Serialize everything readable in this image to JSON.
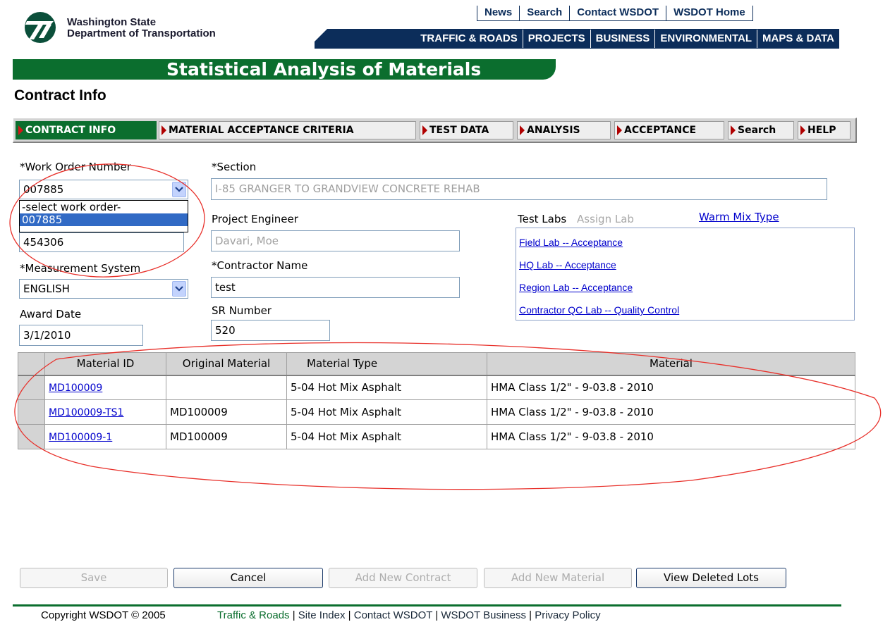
{
  "header": {
    "logo_line1": "Washington State",
    "logo_line2": "Department of Transportation",
    "logo_icon": "wsdot-logo-icon",
    "util_links": [
      "News",
      "Search",
      "Contact WSDOT",
      "WSDOT Home"
    ],
    "nav_items": [
      "TRAFFIC & ROADS",
      "PROJECTS",
      "BUSINESS",
      "ENVIRONMENTAL",
      "MAPS & DATA"
    ],
    "banner_title": "Statistical Analysis of Materials",
    "page_title": "Contract Info"
  },
  "tabs": [
    {
      "label": "CONTRACT INFO",
      "active": true
    },
    {
      "label": "MATERIAL ACCEPTANCE CRITERIA",
      "active": false
    },
    {
      "label": "TEST DATA",
      "active": false
    },
    {
      "label": "ANALYSIS",
      "active": false
    },
    {
      "label": "ACCEPTANCE",
      "active": false
    },
    {
      "label": "Search",
      "active": false
    },
    {
      "label": "HELP",
      "active": false
    }
  ],
  "form": {
    "work_order_label": "*Work Order Number",
    "work_order_value": "007885",
    "work_order_options": [
      "-select work order-",
      "007885",
      "454306"
    ],
    "work_order_selected_option": "007885",
    "section_label": "*Section",
    "section_value": "I-85 GRANGER TO GRANDVIEW CONCRETE REHAB",
    "project_engineer_label": "Project Engineer",
    "project_engineer_value": "Davari, Moe",
    "measurement_label": "*Measurement System",
    "measurement_value": "ENGLISH",
    "contractor_label": "*Contractor Name",
    "contractor_value": "test",
    "award_date_label": "Award Date",
    "award_date_value": "3/1/2010",
    "sr_number_label": "SR Number",
    "sr_number_value": "520"
  },
  "test_labs": {
    "title": "Test Labs",
    "assign_lab": "Assign Lab",
    "warm_mix_link": "Warm Mix Type",
    "labs": [
      "Field Lab -- Acceptance",
      "HQ Lab -- Acceptance",
      "Region Lab -- Acceptance",
      "Contractor QC Lab -- Quality Control"
    ]
  },
  "materials_table": {
    "columns": [
      "Material ID",
      "Original Material",
      "Material Type",
      "Material"
    ],
    "rows": [
      {
        "material_id": "MD100009",
        "original": "",
        "type": "5-04 Hot Mix Asphalt",
        "material": "HMA Class 1/2\" - 9-03.8 - 2010"
      },
      {
        "material_id": "MD100009-TS1",
        "original": "MD100009",
        "type": "5-04 Hot Mix Asphalt",
        "material": "HMA Class 1/2\" - 9-03.8 - 2010"
      },
      {
        "material_id": "MD100009-1",
        "original": "MD100009",
        "type": "5-04 Hot Mix Asphalt",
        "material": "HMA Class 1/2\" - 9-03.8 - 2010"
      }
    ]
  },
  "buttons": {
    "save": "Save",
    "cancel": "Cancel",
    "add_contract": "Add New Contract",
    "add_material": "Add New Material",
    "view_deleted": "View Deleted Lots"
  },
  "footer": {
    "copyright": "Copyright WSDOT © 2005",
    "links": [
      "Traffic & Roads",
      "Site Index",
      "Contact WSDOT",
      "WSDOT Business",
      "Privacy Policy"
    ],
    "separator": " | "
  },
  "colors": {
    "brand_green": "#0b6e2e",
    "nav_navy": "#0c2d5a",
    "annotation_red": "#e8302a",
    "tab_arrow": "#b00000"
  }
}
